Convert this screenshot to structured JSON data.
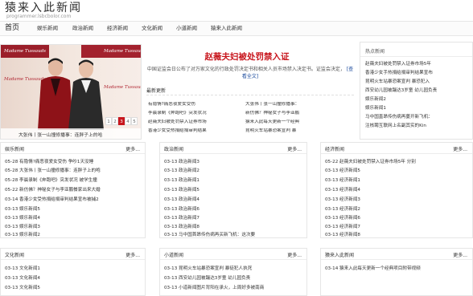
{
  "logo": {
    "title": "猿来入此新闻",
    "subtitle": "programmer.lsbcbolor.com"
  },
  "nav": {
    "home": "首页",
    "items": [
      "娱乐新闻",
      "政治新闻",
      "经济新闻",
      "文化新闻",
      "小道新闻",
      "猿来入此新闻"
    ]
  },
  "slider": {
    "brand": "Madame Tussauds",
    "caption": "大张伟丨张一山撞修播事：连胖子上的哈",
    "pages": [
      "1",
      "2",
      "3",
      "4",
      "5"
    ],
    "active_page": "3"
  },
  "headline": {
    "title": "赵薇夫妇被处罚禁入证",
    "summary": "中国证监会日公布了对万家文化的行政处罚决定书和相关人员市场禁入决定书。证监会决定，",
    "more": "[查看全文]"
  },
  "recent": {
    "title": "最新更新",
    "left": [
      "有隐情?痛恶夜爱女受伤",
      "李晨录制《奔跑吧》突发状况",
      "赵薇夫妇被处罚禁入证券市场",
      "香港少女受热捐给捐审判结果"
    ],
    "right": [
      "大张伟丨张一山撞修播事：",
      "新仿佛？神秘女子与李亚鹏",
      "猿来入此每天更新一个经典",
      "昆明火车站暴恐案宣判 暴"
    ]
  },
  "hot": {
    "title": "热点新闻",
    "items": [
      "赵薇夫妇被处罚禁入证券市场5年",
      "香港少女手热捐给捐审判结果宣布",
      "昆明火车站暴恐案宣判 暴恐犯入",
      "西安幼儿园被踹达3岁童 幼儿园负责",
      "娱乐新闻2",
      "娱乐新闻1",
      "马中国直昂传伤病再蔓开新飞机：",
      "注核聘互联网上名副其实的Kin"
    ]
  },
  "sections": {
    "ent": {
      "title": "娱乐新闻",
      "more": "更多...",
      "items": [
        "05-28 有隐情?痛恶夜爱女受伤 争吵1天没睡",
        "05-28 大张伟丨张一山撞修播事：连胖子上的咆",
        "05-28 李晨录制《奔跑吧》突发状况 被学生撞",
        "05-22 新仿佛？神秘女子与李亚鹏餐家出来大婚",
        "03-14 香港少女受热捐给捐审判结果宣布被捕2",
        "03-13 娱乐新闻5",
        "03-13 娱乐新闻4",
        "03-13 娱乐新闻3",
        "03-13 娱乐新闻2"
      ]
    },
    "pol": {
      "title": "政治新闻",
      "more": "更多...",
      "items": [
        "03-13 政治新闻3",
        "03-13 政治新闻2",
        "03-13 政治新闻1",
        "03-13 政治新闻5",
        "03-13 政治新闻4",
        "03-13 政治新闻6",
        "03-13 政治新闻7",
        "03-13 政治新闻8",
        "03-13 马中国首昂传伤病再买新飞机：这次要"
      ]
    },
    "eco": {
      "title": "经济新闻",
      "more": "更多...",
      "items": [
        "05-22 赵薇夫妇被处罚禁入证券市场5年 分别",
        "03-13 经济新闻5",
        "03-13 经济新闻1",
        "03-13 经济新闻4",
        "03-13 经济新闻3",
        "03-13 经济新闻2",
        "03-13 经济新闻6",
        "03-13 经济新闻7",
        "03-13 经济新闻8"
      ]
    },
    "cul": {
      "title": "文化新闻",
      "more": "更多...",
      "items": [
        "03-13 文化新闻1",
        "03-13 文化新闻4",
        "03-13 文化新闻5"
      ]
    },
    "gos": {
      "title": "小道新闻",
      "more": "更多...",
      "items": [
        "03-13 昆明火车站暴恐案宣判 暴徒犯人执死",
        "03-13 西安幼儿园被踹达3岁童 幼儿园负责",
        "03-13 小道新闻图片背阳在承火，上周好多被南商"
      ]
    },
    "yuan": {
      "title": "猿来入此新闻",
      "more": "更多...",
      "items": [
        "03-14 猿来入此每天更新一个经典项目附带视频"
      ]
    }
  },
  "colors": {
    "accent": "#c8161d",
    "link": "#1a4a9c"
  }
}
